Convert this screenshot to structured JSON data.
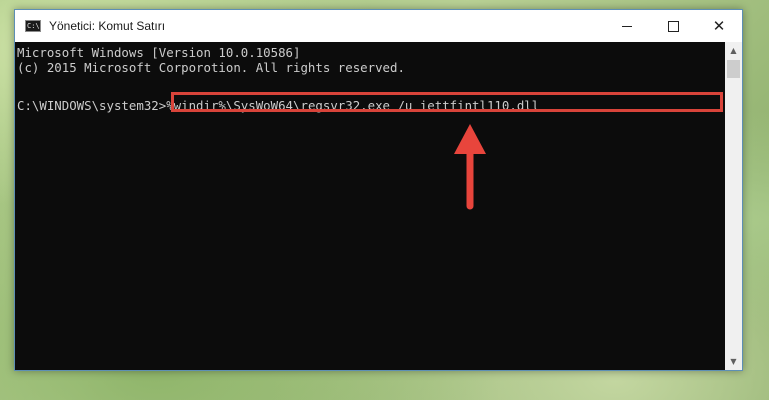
{
  "window": {
    "title": "Yönetici: Komut Satırı",
    "icon": "cmd-icon",
    "icon_label": "C:\\"
  },
  "controls": {
    "minimize_icon": "minimize-icon",
    "maximize_icon": "maximize-icon",
    "close_icon": "close-icon",
    "close_glyph": "✕"
  },
  "console": {
    "line1": "Microsoft Windows [Version 10.0.10586]",
    "line2": "(c) 2015 Microsoft Corporotion. All rights reserved.",
    "prompt": "C:\\WINDOWS\\system32>",
    "command": "%windir%\\SysWoW64\\regsvr32.exe /u iettfintl110.dll"
  },
  "scrollbar": {
    "up_glyph": "▲",
    "down_glyph": "▼"
  },
  "colors": {
    "console_bg": "#0c0c0c",
    "console_text": "#cccccc",
    "highlight": "#d9443a",
    "arrow": "#e8453c"
  }
}
